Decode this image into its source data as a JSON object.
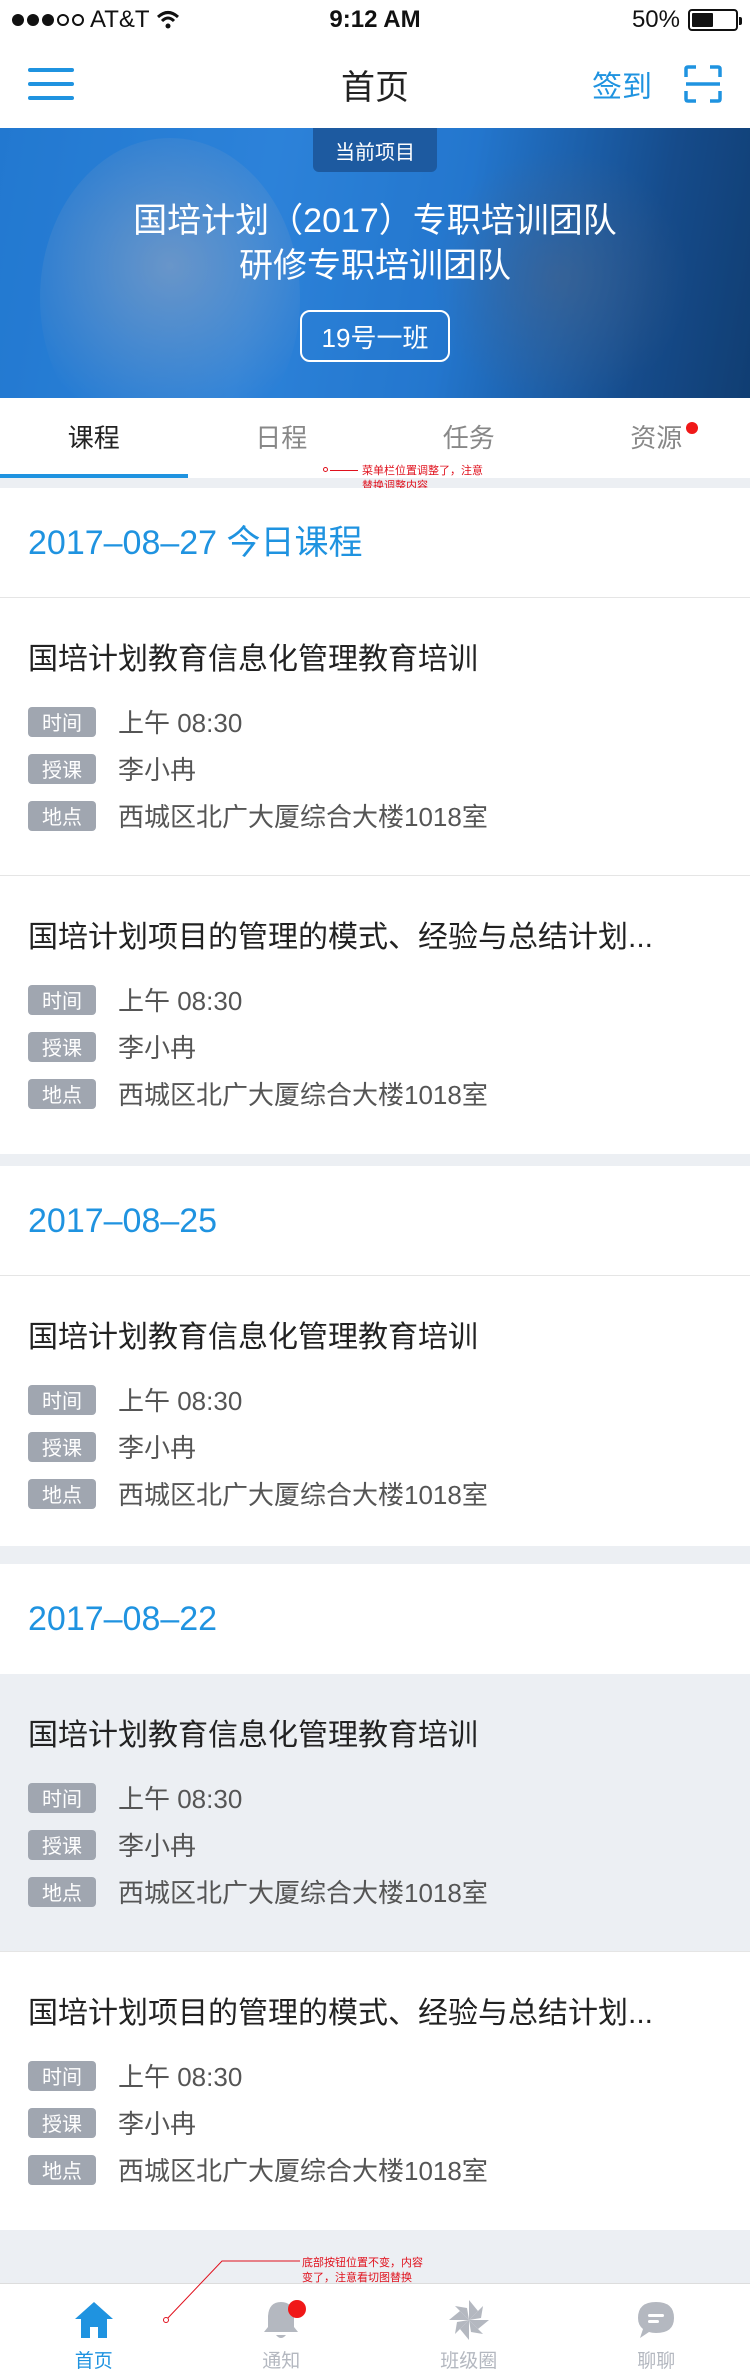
{
  "status_bar": {
    "carrier": "AT&T",
    "time": "9:12 AM",
    "battery": "50%",
    "battery_level": 0.5
  },
  "nav": {
    "title": "首页",
    "checkin_label": "签到"
  },
  "banner": {
    "tag": "当前项目",
    "title_line1": "国培计划（2017）专职培训团队",
    "title_line2": "研修专职培训团队",
    "class_label": "19号一班"
  },
  "tabs": [
    {
      "label": "课程",
      "active": true
    },
    {
      "label": "日程",
      "active": false
    },
    {
      "label": "任务",
      "active": false
    },
    {
      "label": "资源",
      "active": false,
      "badge": true
    }
  ],
  "annotations": {
    "tabs_note_line1": "菜单栏位置调整了，注意",
    "tabs_note_line2": "替换调整内容",
    "bottom_note_line1": "底部按钮位置不变，内容",
    "bottom_note_line2": "变了，注意看切图替换"
  },
  "field_labels": {
    "time": "时间",
    "teacher": "授课",
    "place": "地点"
  },
  "sections": [
    {
      "date": "2017–08–27  今日课程",
      "courses": [
        {
          "title": "国培计划教育信息化管理教育培训",
          "time": "上午 08:30",
          "teacher": "李小冉",
          "place": "西城区北广大厦综合大楼1018室"
        },
        {
          "title": "国培计划项目的管理的模式、经验与总结计划...",
          "time": "上午 08:30",
          "teacher": "李小冉",
          "place": "西城区北广大厦综合大楼1018室"
        }
      ]
    },
    {
      "date": "2017–08–25",
      "courses": [
        {
          "title": "国培计划教育信息化管理教育培训",
          "time": "上午 08:30",
          "teacher": "李小冉",
          "place": "西城区北广大厦综合大楼1018室"
        }
      ]
    },
    {
      "date": "2017–08–22",
      "courses": [
        {
          "title": "国培计划教育信息化管理教育培训",
          "time": "上午 08:30",
          "teacher": "李小冉",
          "place": "西城区北广大厦综合大楼1018室",
          "highlight": true
        },
        {
          "title": "国培计划项目的管理的模式、经验与总结计划...",
          "time": "上午 08:30",
          "teacher": "李小冉",
          "place": "西城区北广大厦综合大楼1018室"
        }
      ]
    }
  ],
  "bottom_bar": [
    {
      "label": "首页",
      "icon": "home-icon",
      "active": true
    },
    {
      "label": "通知",
      "icon": "bell-icon",
      "active": false,
      "badge": true
    },
    {
      "label": "班级圈",
      "icon": "pinwheel-icon",
      "active": false
    },
    {
      "label": "聊聊",
      "icon": "chat-bubble-icon",
      "active": false
    }
  ],
  "colors": {
    "accent": "#1f93e0",
    "tag_gray": "#a0a6b0",
    "badge_red": "#f01818",
    "divider": "#eceff3"
  }
}
